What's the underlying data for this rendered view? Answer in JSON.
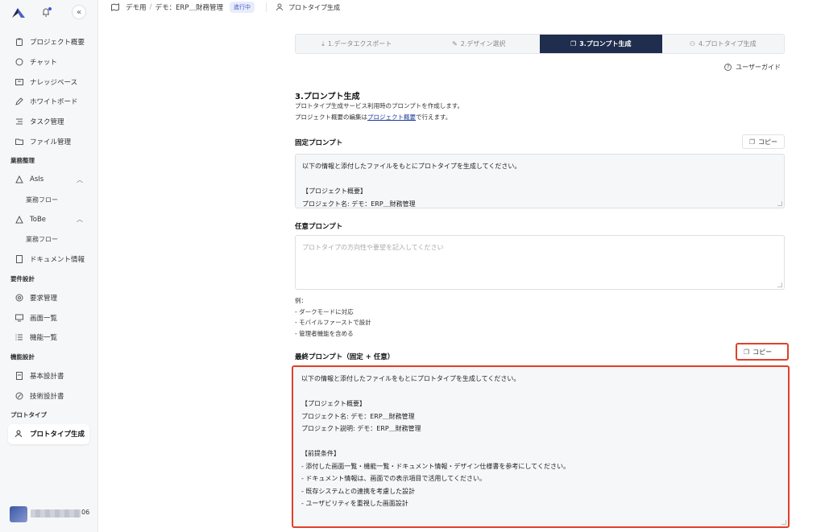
{
  "sidebar": {
    "items": [
      {
        "label": "プロジェクト概要",
        "icon": "clipboard-icon"
      },
      {
        "label": "チャット",
        "icon": "chat-icon"
      },
      {
        "label": "ナレッジベース",
        "icon": "knowledge-icon"
      },
      {
        "label": "ホワイトボード",
        "icon": "pen-icon"
      },
      {
        "label": "タスク管理",
        "icon": "tasks-icon"
      },
      {
        "label": "ファイル管理",
        "icon": "folder-icon"
      }
    ],
    "sections": {
      "gyomu": "業務整理",
      "yoken": "要件設計",
      "kino": "機能設計",
      "proto": "プロトタイプ"
    },
    "asis": {
      "label": "AsIs",
      "sub": "業務フロー"
    },
    "tobe": {
      "label": "ToBe",
      "sub": "業務フロー"
    },
    "doc_info": "ドキュメント情報",
    "req_items": [
      {
        "label": "要求管理",
        "icon": "target-icon"
      },
      {
        "label": "画面一覧",
        "icon": "monitor-icon"
      },
      {
        "label": "機能一覧",
        "icon": "list-icon"
      }
    ],
    "func_items": [
      {
        "label": "基本設計書",
        "icon": "document-icon"
      },
      {
        "label": "技術設計書",
        "icon": "compass-icon"
      }
    ],
    "proto_item": {
      "label": "プロトタイプ生成",
      "icon": "users-icon"
    },
    "user_suffix": "06"
  },
  "topbar": {
    "crumb1": "デモ用",
    "crumb_sep": "/",
    "crumb2": "デモ：ERP＿財務管理",
    "badge": "進行中",
    "page": "プロトタイプ生成"
  },
  "steps": [
    {
      "label": "1.データエクスポート",
      "icon": "download-icon"
    },
    {
      "label": "2.デザイン選択",
      "icon": "brush-icon"
    },
    {
      "label": "3.プロンプト生成",
      "icon": "chat-bubbles-icon"
    },
    {
      "label": "4.プロトタイプ生成",
      "icon": "users-icon"
    }
  ],
  "guide": "ユーザーガイド",
  "section": {
    "title": "3.プロンプト生成",
    "desc1": "プロトタイプ生成サービス利用時のプロンプトを作成します。",
    "desc2_pre": "プロジェクト概要の編集は",
    "desc2_link": "プロジェクト概要",
    "desc2_post": "で行えます。"
  },
  "fixed": {
    "label": "固定プロンプト",
    "copy": "コピー",
    "text": "以下の情報と添付したファイルをもとにプロトタイプを生成してください。\n\n【プロジェクト概要】\nプロジェクト名: デモ：ERP＿財務管理"
  },
  "free": {
    "label": "任意プロンプト",
    "placeholder": "プロトタイプの方向性や要望を記入してください"
  },
  "examples": "例：\n- ダークモードに対応\n- モバイルファーストで設計\n- 管理者機能を含める",
  "final": {
    "label": "最終プロンプト（固定 + 任意）",
    "copy": "コピー",
    "text": "以下の情報と添付したファイルをもとにプロトタイプを生成してください。\n\n【プロジェクト概要】\nプロジェクト名: デモ：ERP＿財務管理\nプロジェクト説明: デモ：ERP＿財務管理\n\n【前提条件】\n- 添付した画面一覧・機能一覧・ドキュメント情報・デザイン仕様書を参考にしてください。\n- ドキュメント情報は、画面での表示項目で活用してください。\n- 既存システムとの連携を考慮した設計\n- ユーザビリティを重視した画面設計"
  },
  "colors": {
    "accent": "#1f2d4e",
    "highlight": "#e0402a",
    "link": "#1e3a9a"
  }
}
